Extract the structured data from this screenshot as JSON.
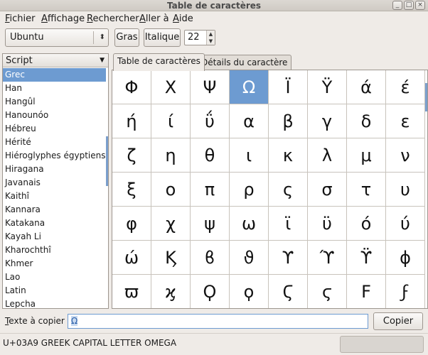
{
  "window": {
    "title": "Table de caractères",
    "buttons": [
      "_",
      "□",
      "×"
    ]
  },
  "menubar": {
    "items": [
      "Fichier",
      "Affichage",
      "Rechercher",
      "Aller à",
      "Aide"
    ]
  },
  "toolbar": {
    "font_name": "Ubuntu",
    "combo_arrow": "⬍",
    "bold_label": "Gras",
    "italic_label": "Italique",
    "size_value": "22",
    "spin_up": "▲",
    "spin_down": "▼"
  },
  "script_panel": {
    "header": "Script",
    "header_arrow": "▼",
    "selected_index": 0,
    "items": [
      "Grec",
      "Han",
      "Hangûl",
      "Hanounóo",
      "Hébreu",
      "Hérité",
      "Hiéroglyphes égyptiens",
      "Hiragana",
      "Javanais",
      "Kaithî",
      "Kannara",
      "Katakana",
      "Kayah Li",
      "Kharochthî",
      "Khmer",
      "Lao",
      "Latin",
      "Lepcha"
    ]
  },
  "tabs": {
    "table_label": "Table de caractères",
    "details_label": "Détails du caractère"
  },
  "grid": {
    "selected": [
      0,
      3
    ],
    "rows": [
      [
        "Φ",
        "Χ",
        "Ψ",
        "Ω",
        "Ϊ",
        "Ϋ",
        "ά",
        "έ"
      ],
      [
        "ή",
        "ί",
        "ΰ",
        "α",
        "β",
        "γ",
        "δ",
        "ε"
      ],
      [
        "ζ",
        "η",
        "θ",
        "ι",
        "κ",
        "λ",
        "μ",
        "ν"
      ],
      [
        "ξ",
        "ο",
        "π",
        "ρ",
        "ς",
        "σ",
        "τ",
        "υ"
      ],
      [
        "φ",
        "χ",
        "ψ",
        "ω",
        "ϊ",
        "ϋ",
        "ό",
        "ύ"
      ],
      [
        "ώ",
        "Ϗ",
        "ϐ",
        "ϑ",
        "ϒ",
        "ϓ",
        "ϔ",
        "ϕ"
      ],
      [
        "ϖ",
        "ϗ",
        "Ϙ",
        "ϙ",
        "Ϛ",
        "ϛ",
        "Ϝ",
        "ϝ"
      ]
    ]
  },
  "copy": {
    "label": "Texte à copier :",
    "value": "Ω",
    "button_label": "Copier"
  },
  "status": {
    "text": "U+03A9 GREEK CAPITAL LETTER OMEGA"
  }
}
